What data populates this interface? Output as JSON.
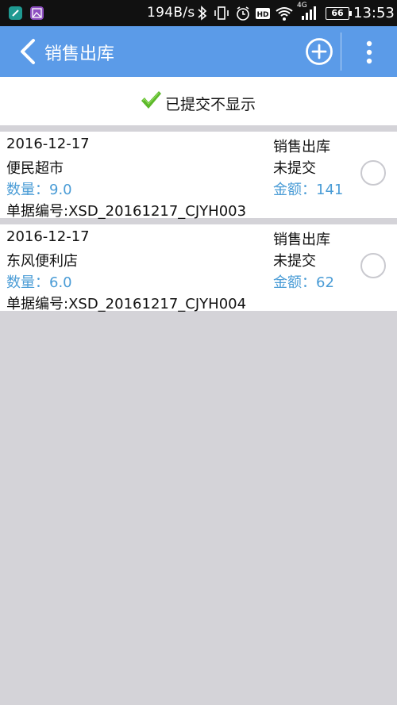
{
  "status_bar": {
    "net_speed": "194B/s",
    "battery": "66",
    "time": "13:53",
    "network": "4G"
  },
  "app_bar": {
    "title": "销售出库"
  },
  "filter": {
    "label": "已提交不显示"
  },
  "records": [
    {
      "date": "2016-12-17",
      "customer": "便民超市",
      "quantity": "数量：9.0",
      "doc_no": "单据编号:XSD_20161217_CJYH003",
      "type": "销售出库",
      "status": "未提交",
      "amount": "金额：141",
      "checked": false
    },
    {
      "date": "2016-12-17",
      "customer": "东风便利店",
      "quantity": "数量：6.0",
      "doc_no": "单据编号:XSD_20161217_CJYH004",
      "type": "销售出库",
      "status": "未提交",
      "amount": "金额：62",
      "checked": false
    }
  ],
  "colors": {
    "app_bar": "#5b9be8",
    "accent_text": "#4a9cd6",
    "background": "#d4d3d8",
    "check_green": "#5cb82a"
  },
  "icons": [
    "back-arrow-icon",
    "add-circle-icon",
    "more-vertical-icon",
    "check-mark-icon",
    "bluetooth-icon",
    "vibrate-icon",
    "alarm-icon",
    "hd-icon",
    "wifi-icon",
    "signal-icon",
    "battery-icon"
  ]
}
